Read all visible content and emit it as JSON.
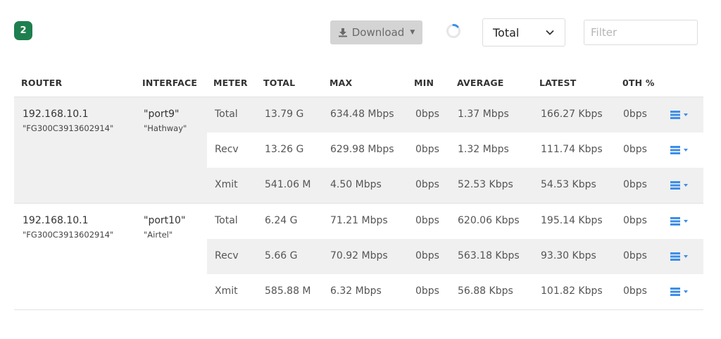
{
  "header": {
    "badge_count": "2",
    "download_label": "Download",
    "total_select_value": "Total",
    "filter_placeholder": "Filter"
  },
  "colors": {
    "badge": "#1e7f4e",
    "accent": "#3d8ee8",
    "row_shade": "#f0f0f0"
  },
  "table": {
    "columns": [
      "ROUTER",
      "INTERFACE",
      "METER",
      "TOTAL",
      "MAX",
      "MIN",
      "AVERAGE",
      "LATEST",
      "0TH %"
    ],
    "groups": [
      {
        "router_ip": "192.168.10.1",
        "router_serial": "\"FG300C3913602914\"",
        "interface": "\"port9\"",
        "interface_alias": "\"Hathway\"",
        "rows": [
          {
            "meter": "Total",
            "total": "13.79 G",
            "max": "634.48 Mbps",
            "min": "0bps",
            "average": "1.37 Mbps",
            "latest": "166.27 Kbps",
            "pct": "0bps"
          },
          {
            "meter": "Recv",
            "total": "13.26 G",
            "max": "629.98 Mbps",
            "min": "0bps",
            "average": "1.32 Mbps",
            "latest": "111.74 Kbps",
            "pct": "0bps"
          },
          {
            "meter": "Xmit",
            "total": "541.06 M",
            "max": "4.50 Mbps",
            "min": "0bps",
            "average": "52.53 Kbps",
            "latest": "54.53 Kbps",
            "pct": "0bps"
          }
        ]
      },
      {
        "router_ip": "192.168.10.1",
        "router_serial": "\"FG300C3913602914\"",
        "interface": "\"port10\"",
        "interface_alias": "\"Airtel\"",
        "rows": [
          {
            "meter": "Total",
            "total": "6.24 G",
            "max": "71.21 Mbps",
            "min": "0bps",
            "average": "620.06 Kbps",
            "latest": "195.14 Kbps",
            "pct": "0bps"
          },
          {
            "meter": "Recv",
            "total": "5.66 G",
            "max": "70.92 Mbps",
            "min": "0bps",
            "average": "563.18 Kbps",
            "latest": "93.30 Kbps",
            "pct": "0bps"
          },
          {
            "meter": "Xmit",
            "total": "585.88 M",
            "max": "6.32 Mbps",
            "min": "0bps",
            "average": "56.88 Kbps",
            "latest": "101.82 Kbps",
            "pct": "0bps"
          }
        ]
      }
    ]
  }
}
